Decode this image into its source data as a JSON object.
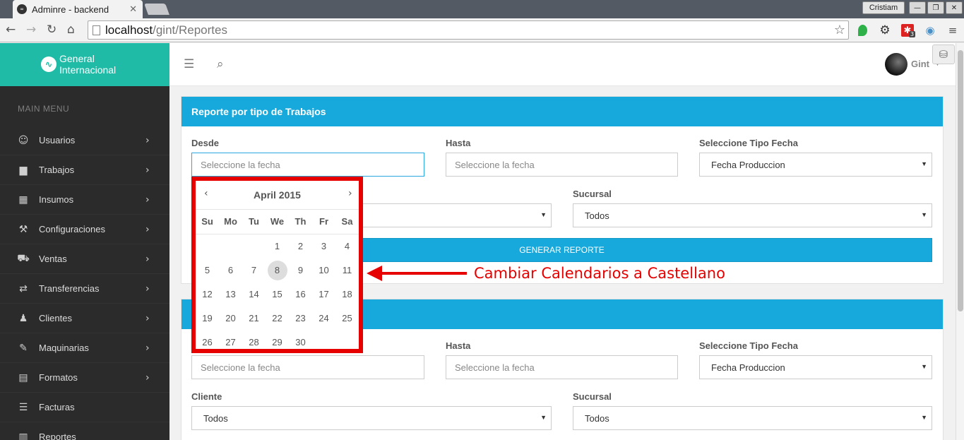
{
  "browser": {
    "tab_title": "Adminre - backend",
    "user_label": "Cristiam",
    "url_host": "localhost",
    "url_path": "/gint/Reportes",
    "extension_badge": "3"
  },
  "brand": {
    "name_line1": "General",
    "name_line2": "Internacional",
    "logo_icon": "wave-logo-icon"
  },
  "sidebar": {
    "title": "MAIN MENU",
    "items": [
      {
        "label": "Usuarios",
        "icon": "users-icon"
      },
      {
        "label": "Trabajos",
        "icon": "briefcase-icon"
      },
      {
        "label": "Insumos",
        "icon": "grid-icon"
      },
      {
        "label": "Configuraciones",
        "icon": "wrench-icon"
      },
      {
        "label": "Ventas",
        "icon": "cart-icon"
      },
      {
        "label": "Transferencias",
        "icon": "transfer-icon"
      },
      {
        "label": "Clientes",
        "icon": "user-icon"
      },
      {
        "label": "Maquinarias",
        "icon": "machine-icon"
      },
      {
        "label": "Formatos",
        "icon": "formats-icon"
      },
      {
        "label": "Facturas",
        "icon": "list-icon"
      },
      {
        "label": "Reportes",
        "icon": "calendar-icon"
      }
    ]
  },
  "topbar": {
    "username": "Gint"
  },
  "panel1": {
    "title": "Reporte por tipo de Trabajos",
    "desde_label": "Desde",
    "desde_placeholder": "Seleccione la fecha",
    "hasta_label": "Hasta",
    "hasta_placeholder": "Seleccione la fecha",
    "tipo_label": "Seleccione Tipo Fecha",
    "tipo_value": "Fecha Produccion",
    "sucursal_label": "Sucursal",
    "sucursal_value": "Todos",
    "button": "GENERAR REPORTE"
  },
  "panel2": {
    "hasta_label": "Hasta",
    "hasta_placeholder": "Seleccione la fecha",
    "desde_placeholder": "Seleccione la fecha",
    "tipo_label": "Seleccione Tipo Fecha",
    "tipo_value": "Fecha Produccion",
    "cliente_label": "Cliente",
    "cliente_value": "Todos",
    "sucursal_label": "Sucursal",
    "sucursal_value": "Todos"
  },
  "datepicker": {
    "month_title": "April 2015",
    "weekdays": [
      "Su",
      "Mo",
      "Tu",
      "We",
      "Th",
      "Fr",
      "Sa"
    ],
    "weeks": [
      [
        "",
        "",
        "",
        "1",
        "2",
        "3",
        "4"
      ],
      [
        "5",
        "6",
        "7",
        "8",
        "9",
        "10",
        "11"
      ],
      [
        "12",
        "13",
        "14",
        "15",
        "16",
        "17",
        "18"
      ],
      [
        "19",
        "20",
        "21",
        "22",
        "23",
        "24",
        "25"
      ],
      [
        "26",
        "27",
        "28",
        "29",
        "30",
        "",
        ""
      ]
    ],
    "today": "8"
  },
  "annotation": {
    "text": "Cambiar Calendarios a Castellano",
    "color": "#e60000"
  },
  "colors": {
    "accent": "#18a9dc",
    "brand": "#1fbba6",
    "sidebar": "#2b2b2b"
  }
}
